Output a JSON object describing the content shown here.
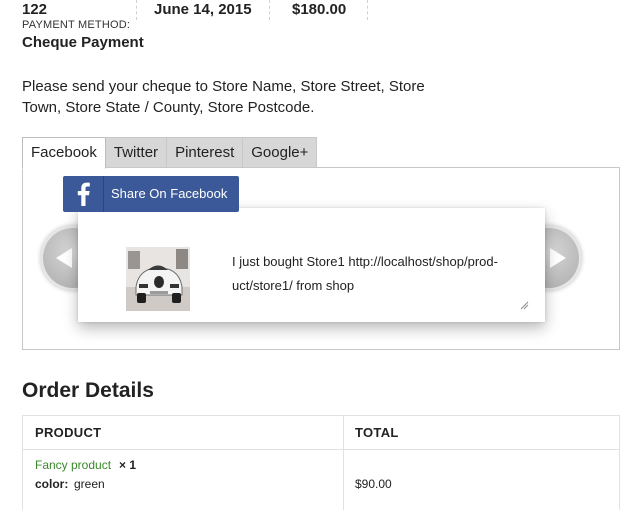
{
  "order_overview": {
    "order_number": "122",
    "date": "June 14, 2015",
    "total": "$180.00",
    "payment_method_label": "PAYMENT METHOD:",
    "payment_method": "Cheque Payment"
  },
  "payment_instructions": "Please send your cheque to Store Name, Store Street, Store Town, Store State / County, Store Postcode.",
  "share": {
    "tabs": [
      {
        "label": "Facebook",
        "active": true
      },
      {
        "label": "Twitter",
        "active": false
      },
      {
        "label": "Pinterest",
        "active": false
      },
      {
        "label": "Google+",
        "active": false
      }
    ],
    "button_label": "Share On Facebook",
    "message": "I just bought Store1 http://localhost/shop/prod-uct/store1/ from shop",
    "brand_color": "#3b5998",
    "icons": {
      "prev": "chevron-left-icon",
      "next": "chevron-right-icon",
      "facebook": "facebook-f-icon",
      "resize": "resize-grip-icon"
    }
  },
  "order_details": {
    "heading": "Order Details",
    "columns": [
      "PRODUCT",
      "TOTAL"
    ],
    "items": [
      {
        "name": "Fancy product",
        "quantity": "× 1",
        "meta_key": "color:",
        "meta_value": "green",
        "total": "$90.00"
      }
    ],
    "link_color": "#3a8a2c"
  }
}
